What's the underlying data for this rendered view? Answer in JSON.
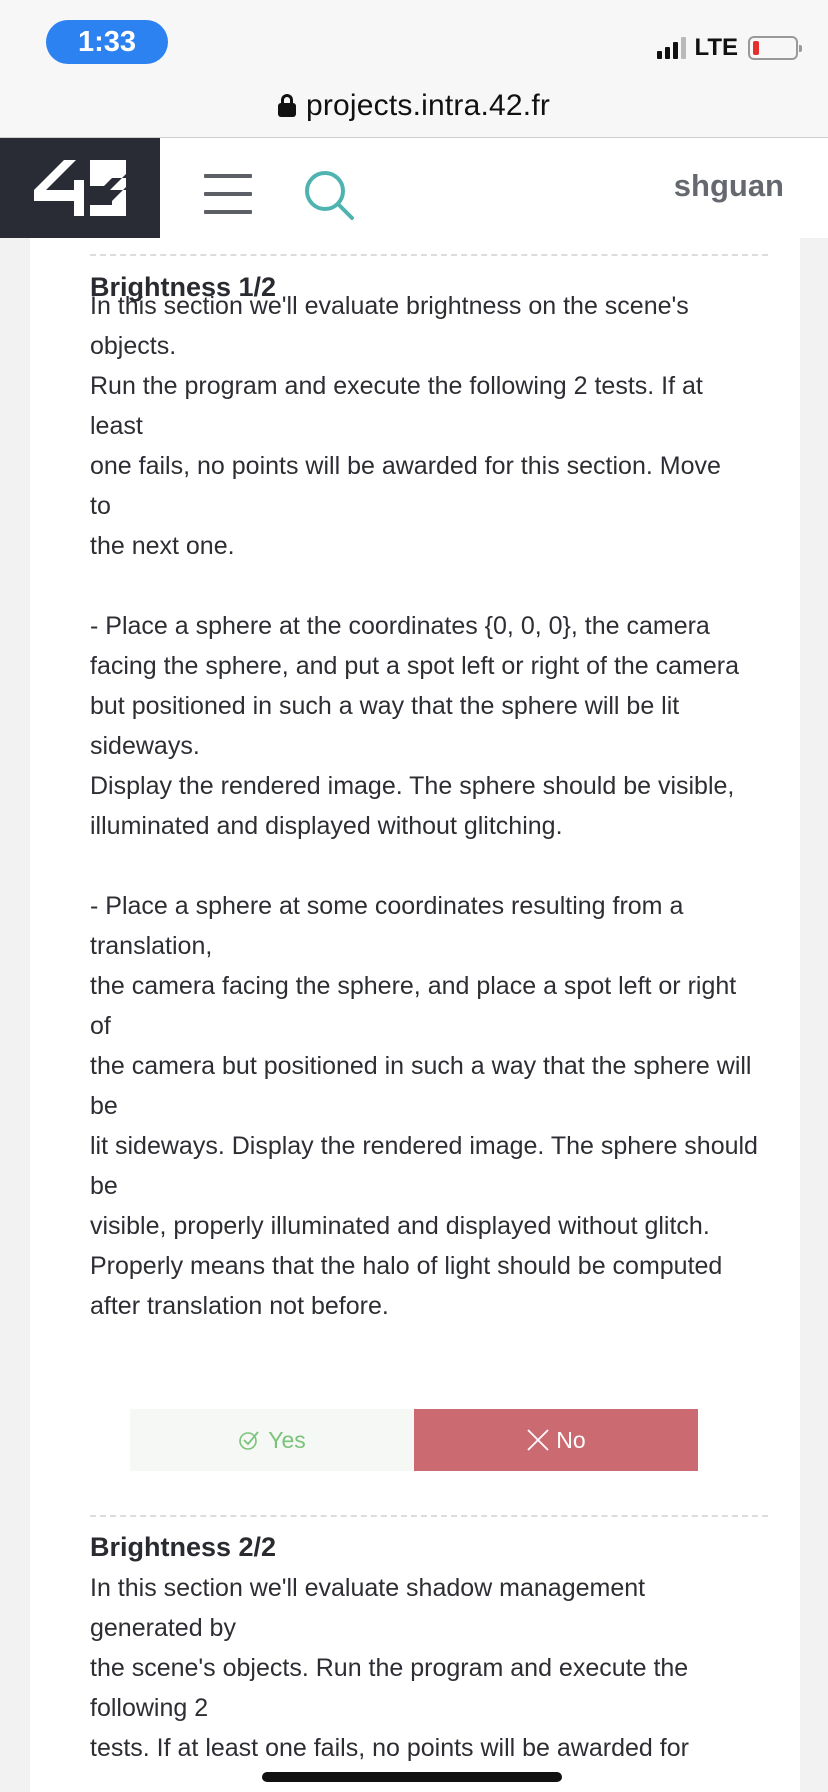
{
  "status_bar": {
    "time": "1:33",
    "network": "LTE"
  },
  "browser": {
    "url": "projects.intra.42.fr"
  },
  "header": {
    "logo_text": "42",
    "username": "shguan"
  },
  "sections": [
    {
      "title": "Brightness 1/2",
      "body": "In this section we'll evaluate brightness on the scene's\nobjects.\nRun the program and execute the following 2 tests. If at\nleast\none fails, no points will be awarded for this section. Move\nto\nthe next one.\n\n- Place a sphere at the coordinates {0, 0, 0}, the camera\nfacing the sphere, and put a spot left or right of the camera\nbut positioned in such a way that the sphere will be lit\nsideways.\nDisplay the rendered image. The sphere should be visible,\nilluminated and displayed without glitching.\n\n- Place a sphere at some coordinates resulting from a\ntranslation,\nthe camera facing the sphere, and place a spot left or right\nof\nthe camera but positioned in such a way that the sphere will\nbe\nlit sideways. Display the rendered image. The sphere should\nbe\nvisible, properly illuminated and displayed without glitch.\nProperly means that the halo of light should be computed\nafter translation not before.",
      "yes_label": "Yes",
      "no_label": "No"
    },
    {
      "title": "Brightness 2/2",
      "body": "In this section we'll evaluate shadow management\ngenerated by\nthe scene's objects. Run the program and execute the\nfollowing 2\ntests. If at least one fails, no points will be awarded for"
    }
  ],
  "colors": {
    "accent_search": "#4fb3b0",
    "logo_bg": "#2a2c35",
    "yes_text": "#7ac47a",
    "no_bg": "#cb6a70",
    "time_pill": "#2d82f1"
  }
}
